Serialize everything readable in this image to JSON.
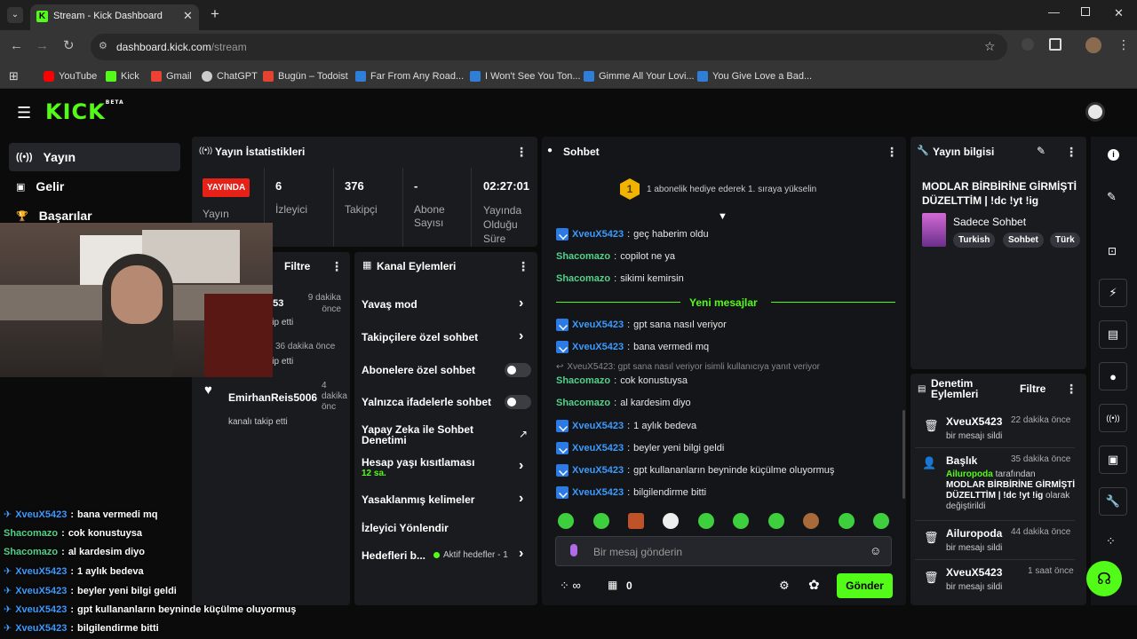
{
  "browser": {
    "tab_title": "Stream - Kick Dashboard",
    "url_host": "dashboard.kick.com",
    "url_path": "/stream",
    "bookmarks": [
      {
        "label": "YouTube",
        "color": "#ff0000"
      },
      {
        "label": "Kick",
        "color": "#53fc18"
      },
      {
        "label": "Gmail",
        "color": "#ea4335"
      },
      {
        "label": "ChatGPT",
        "color": "#cccccc"
      },
      {
        "label": "Bugün – Todoist",
        "color": "#e44332"
      },
      {
        "label": "Far From Any Road...",
        "color": "#2f7fd8"
      },
      {
        "label": "I Won't See You Ton...",
        "color": "#2f7fd8"
      },
      {
        "label": "Gimme All Your Lovi...",
        "color": "#2f7fd8"
      },
      {
        "label": "You Give Love a Bad...",
        "color": "#2f7fd8"
      }
    ]
  },
  "logo": {
    "text": "KICK",
    "beta": "BETA"
  },
  "nav": {
    "items": [
      "Yayın",
      "Gelir",
      "Başarılar"
    ]
  },
  "stats": {
    "title": "Yayın İstatistikleri",
    "live_badge": "YAYINDA",
    "live_label": "Yayın",
    "viewers_value": "6",
    "viewers_label": "İzleyici",
    "followers_value": "376",
    "followers_label": "Takipçi",
    "subs_value": "-",
    "subs_label": "Abone Sayısı",
    "duration_value": "02:27:01",
    "duration_label": "Yayında Olduğu Süre"
  },
  "activity": {
    "filter": "Filtre",
    "items": [
      {
        "name": "...53",
        "time": "9 dakika önce",
        "text": "...ip etti"
      },
      {
        "name": "",
        "time": "36 dakika önce",
        "text": "...ip etti"
      },
      {
        "name": "EmirhanReis5006",
        "time": "4 dakika önc",
        "text": "kanalı takip etti"
      }
    ]
  },
  "channel_actions": {
    "title": "Kanal Eylemleri",
    "items": [
      "Yavaş mod",
      "Takipçilere özel sohbet",
      "Abonelere özel sohbet",
      "Yalnızca ifadelerle sohbet",
      "Yapay Zeka ile Sohbet Denetimi",
      "Hesap yaşı kısıtlaması",
      "Yasaklanmış kelimeler",
      "İzleyici Yönlendir",
      "Hedefleri b..."
    ],
    "age_sub": "12 sa.",
    "goals_status": "Aktif hedefler - 1"
  },
  "chat": {
    "title": "Sohbet",
    "gift_banner": "1 abonelik hediye ederek 1. sıraya yükselin",
    "new_messages": "Yeni mesajlar",
    "reply_note": "XveuX5423: gpt sana nasıl veriyor isimli kullanıcıya yanıt veriyor",
    "messages": [
      {
        "user": "XveuX5423",
        "text": "geç haberim oldu",
        "color": "blue"
      },
      {
        "user": "Shacomazo",
        "text": "copilot ne ya",
        "color": "teal"
      },
      {
        "user": "Shacomazo",
        "text": "sikimi kemirsin",
        "color": "teal"
      },
      {
        "user": "XveuX5423",
        "text": "gpt sana nasıl veriyor",
        "color": "blue"
      },
      {
        "user": "XveuX5423",
        "text": "bana vermedi mq",
        "color": "blue"
      },
      {
        "user": "Shacomazo",
        "text": "cok konustuysa",
        "color": "teal"
      },
      {
        "user": "Shacomazo",
        "text": "al kardesim diyo",
        "color": "teal"
      },
      {
        "user": "XveuX5423",
        "text": "1 aylık bedeva",
        "color": "blue"
      },
      {
        "user": "XveuX5423",
        "text": "beyler yeni bilgi geldi",
        "color": "blue"
      },
      {
        "user": "XveuX5423",
        "text": "gpt kullananların beyninde küçülme oluyormuş",
        "color": "blue"
      },
      {
        "user": "XveuX5423",
        "text": "bilgilendirme bitti",
        "color": "blue"
      }
    ],
    "input_placeholder": "Bir mesaj gönderin",
    "points": "0",
    "send": "Gönder"
  },
  "stream_info": {
    "title": "Yayın bilgisi",
    "stream_title": "MODLAR BİRBİRİNE GİRMİŞTİ DÜZELTTİM | !dc !yt !ig",
    "category": "Sadece Sohbet",
    "tags": [
      "Turkish",
      "Sohbet",
      "Türk"
    ]
  },
  "mod": {
    "title": "Denetim Eylemleri",
    "filter": "Filtre",
    "items": [
      {
        "name": "XveuX5423",
        "time": "22 dakika önce",
        "desc": "bir mesajı sildi"
      },
      {
        "name": "Başlık",
        "time": "35 dakika önce",
        "by": "Ailuropoda",
        "by_suffix": "tarafından",
        "title_text": "MODLAR BİRBİRİNE GİRMİŞTİ DÜZELTTİM | !dc !yt !ig",
        "suffix": "olarak değiştirildi"
      },
      {
        "name": "Ailuropoda",
        "time": "44 dakika önce",
        "desc": "bir mesajı sildi"
      },
      {
        "name": "XveuX5423",
        "time": "1 saat önce",
        "desc": "bir mesajı sildi"
      }
    ]
  },
  "overlay_chat": [
    {
      "user": "XveuX5423",
      "text": "bana vermedi mq",
      "color": "blue"
    },
    {
      "user": "Shacomazo",
      "text": "cok konustuysa",
      "color": "teal"
    },
    {
      "user": "Shacomazo",
      "text": "al kardesim diyo",
      "color": "teal"
    },
    {
      "user": "XveuX5423",
      "text": "1 aylık bedeva",
      "color": "blue"
    },
    {
      "user": "XveuX5423",
      "text": "beyler yeni bilgi geldi",
      "color": "blue"
    },
    {
      "user": "XveuX5423",
      "text": "gpt kullananların beyninde küçülme oluyormuş",
      "color": "blue"
    },
    {
      "user": "XveuX5423",
      "text": "bilgilendirme bitti",
      "color": "blue"
    }
  ]
}
